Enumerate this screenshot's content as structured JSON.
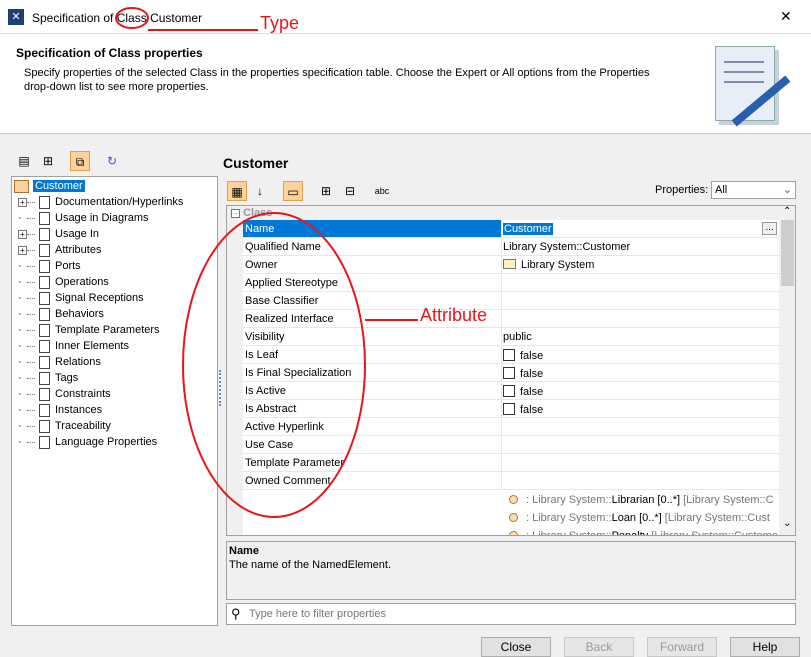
{
  "window": {
    "title_prefix": "Specification of ",
    "title_type": "Class",
    "title_name": " Customer",
    "close": "✕"
  },
  "header": {
    "title": "Specification of Class properties",
    "description": "Specify properties of the selected Class in the properties specification table. Choose the Expert or All options from the Properties drop-down list to see more properties."
  },
  "annotations": {
    "type": "Type",
    "attribute": "Attribute"
  },
  "tree": {
    "root": "Customer",
    "items": [
      {
        "label": "Documentation/Hyperlinks",
        "expandable": true
      },
      {
        "label": "Usage in Diagrams",
        "expandable": false
      },
      {
        "label": "Usage In",
        "expandable": true
      },
      {
        "label": "Attributes",
        "expandable": true
      },
      {
        "label": "Ports",
        "expandable": false
      },
      {
        "label": "Operations",
        "expandable": false
      },
      {
        "label": "Signal Receptions",
        "expandable": false
      },
      {
        "label": "Behaviors",
        "expandable": false
      },
      {
        "label": "Template Parameters",
        "expandable": false
      },
      {
        "label": "Inner Elements",
        "expandable": false
      },
      {
        "label": "Relations",
        "expandable": false
      },
      {
        "label": "Tags",
        "expandable": false
      },
      {
        "label": "Constraints",
        "expandable": false
      },
      {
        "label": "Instances",
        "expandable": false
      },
      {
        "label": "Traceability",
        "expandable": false
      },
      {
        "label": "Language Properties",
        "expandable": false
      }
    ]
  },
  "main": {
    "title": "Customer",
    "properties_label": "Properties:",
    "properties_value": "All",
    "group": "Class",
    "rows": [
      {
        "name": "Name",
        "value": "Customer"
      },
      {
        "name": "Qualified Name",
        "value": "Library System::Customer"
      },
      {
        "name": "Owner",
        "value": "Library System"
      },
      {
        "name": "Applied Stereotype",
        "value": ""
      },
      {
        "name": "Base Classifier",
        "value": ""
      },
      {
        "name": "Realized Interface",
        "value": ""
      },
      {
        "name": "Visibility",
        "value": "public"
      },
      {
        "name": "Is Leaf",
        "value": "false"
      },
      {
        "name": "Is Final Specialization",
        "value": "false"
      },
      {
        "name": "Is Active",
        "value": "false"
      },
      {
        "name": "Is Abstract",
        "value": "false"
      },
      {
        "name": "Active Hyperlink",
        "value": ""
      },
      {
        "name": "Use Case",
        "value": ""
      },
      {
        "name": "Template Parameter",
        "value": ""
      },
      {
        "name": "Owned Comment",
        "value": ""
      }
    ],
    "associations": [
      {
        "pre": ": Library System::",
        "name": "Librarian [0..*]",
        "post": " [Library System::C"
      },
      {
        "pre": ": Library System::",
        "name": "Loan [0..*]",
        "post": " [Library System::Cust"
      },
      {
        "pre": ": Library System::",
        "name": "Penalty",
        "post": " [Library System::Custome"
      }
    ],
    "ellipsis": "...",
    "desc_title": "Name",
    "desc_text": "The name of the NamedElement.",
    "filter_placeholder": "Type here to filter properties"
  },
  "buttons": {
    "close": "Close",
    "back": "Back",
    "forward": "Forward",
    "help": "Help"
  }
}
